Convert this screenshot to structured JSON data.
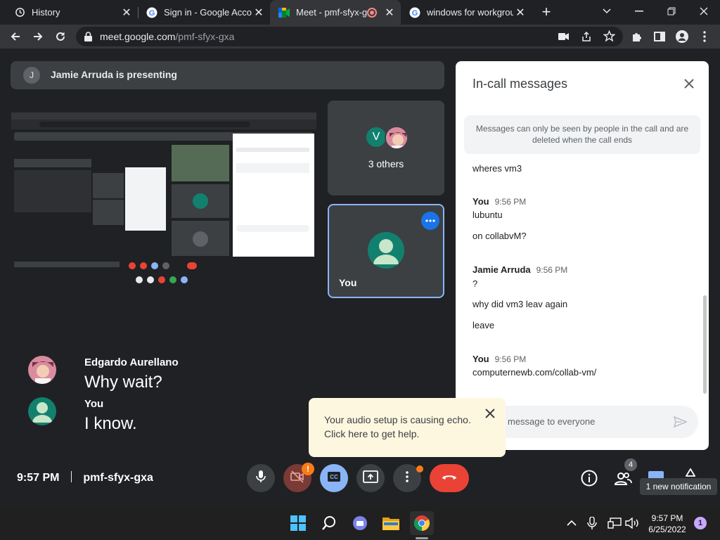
{
  "browser": {
    "tabs": [
      {
        "title": "History",
        "icon": "history-icon"
      },
      {
        "title": "Sign in - Google Accou",
        "icon": "google-icon"
      },
      {
        "title": "Meet - pmf-sfyx-g",
        "icon": "meet-icon"
      },
      {
        "title": "windows for workgrou",
        "icon": "google-icon"
      }
    ],
    "url_host": "meet.google.com",
    "url_path": "/pmf-sfyx-gxa"
  },
  "meet": {
    "presenting_initial": "J",
    "presenting_text": "Jamie Arruda is presenting",
    "others_avatar_initial": "V",
    "others_label": "3 others",
    "you_label": "You",
    "captions": [
      {
        "name": "Edgardo Aurellano",
        "text": "Why wait?"
      },
      {
        "name": "You",
        "text": "I know."
      }
    ],
    "time": "9:57 PM",
    "meeting_code": "pmf-sfyx-gxa",
    "camera_alert": "!",
    "people_count": "4",
    "notification_tooltip": "1 new notification"
  },
  "panel": {
    "title": "In-call messages",
    "note": "Messages can only be seen by people in the call and are deleted when the call ends",
    "messages": [
      {
        "text": "wheres vm3"
      },
      {
        "sender": "You",
        "time": "9:56 PM",
        "lines": [
          "lubuntu",
          "on collabvM?"
        ]
      },
      {
        "sender": "Jamie Arruda",
        "time": "9:56 PM",
        "lines": [
          "?",
          "why did vm3 leav again",
          "leave"
        ]
      },
      {
        "sender": "You",
        "time": "9:56 PM",
        "lines": [
          "computernewb.com/collab-vm/"
        ]
      }
    ],
    "input_placeholder": "Send a message to everyone",
    "input_visible": "message to everyone"
  },
  "toast": {
    "line1": "Your audio setup is causing echo.",
    "line2": "Click here to get help."
  },
  "taskbar": {
    "time": "9:57 PM",
    "date": "6/25/2022",
    "notif_count": "1"
  },
  "colors": {
    "end_call": "#ea4335",
    "captions_active": "#8ab4f8",
    "avatar_green": "#12806f",
    "alert_orange": "#fa7b17"
  }
}
